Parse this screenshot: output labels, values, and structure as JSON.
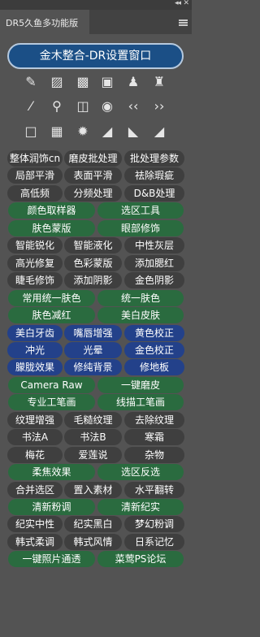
{
  "panel": {
    "title": "DR5久鱼多功能版",
    "collapse_glyph": "◂◂",
    "close_glyph": "✕"
  },
  "main_button": "金木整合-DR设置窗口",
  "icon_rows": [
    [
      {
        "name": "brush-swap-icon",
        "glyph": "✎"
      },
      {
        "name": "bandage-icon",
        "glyph": "▨"
      },
      {
        "name": "bandage-small-icon",
        "glyph": "▩"
      },
      {
        "name": "chip-icon",
        "glyph": "▣"
      },
      {
        "name": "stamp-icon",
        "glyph": "♟"
      },
      {
        "name": "clone-stamp-icon",
        "glyph": "♜"
      }
    ],
    [
      {
        "name": "brush-icon",
        "glyph": "⁄"
      },
      {
        "name": "magnifier-icon",
        "glyph": "⚲"
      },
      {
        "name": "split-view-icon",
        "glyph": "◫"
      },
      {
        "name": "eye-icon",
        "glyph": "◉"
      },
      {
        "name": "chevron-left-icon",
        "glyph": "‹‹"
      },
      {
        "name": "chevron-right-icon",
        "glyph": "››"
      }
    ],
    [
      {
        "name": "white-square-icon",
        "glyph": "□"
      },
      {
        "name": "gradient-icon",
        "glyph": "▦"
      },
      {
        "name": "sparkle-icon",
        "glyph": "✹"
      },
      {
        "name": "levels-icon",
        "glyph": "◢"
      },
      {
        "name": "histogram-icon",
        "glyph": "◣"
      },
      {
        "name": "histogram-alt-icon",
        "glyph": "◢"
      }
    ]
  ],
  "rows": [
    {
      "color": "gray",
      "buttons": [
        "整体润饰cn",
        "磨皮批处理",
        "批处理参数"
      ]
    },
    {
      "color": "gray",
      "buttons": [
        "局部平滑",
        "表面平滑",
        "祛除瑕疵"
      ]
    },
    {
      "color": "gray",
      "buttons": [
        "高低频",
        "分频处理",
        "D&B处理"
      ]
    },
    {
      "color": "green",
      "buttons": [
        "颜色取样器",
        "选区工具"
      ]
    },
    {
      "color": "green",
      "buttons": [
        "肤色蒙版",
        "眼部修饰"
      ]
    },
    {
      "color": "gray",
      "buttons": [
        "智能锐化",
        "智能液化",
        "中性灰层"
      ]
    },
    {
      "color": "gray",
      "buttons": [
        "高光修复",
        "色彩蒙版",
        "添加腮红"
      ]
    },
    {
      "color": "gray",
      "buttons": [
        "睫毛修饰",
        "添加阴影",
        "金色阴影"
      ]
    },
    {
      "color": "green",
      "buttons": [
        "常用统一肤色",
        "统一肤色"
      ]
    },
    {
      "color": "green",
      "buttons": [
        "肤色减红",
        "美白皮肤"
      ]
    },
    {
      "color": "blue",
      "buttons": [
        "美白牙齿",
        "嘴唇增强",
        "黄色校正"
      ]
    },
    {
      "color": "blue",
      "buttons": [
        "冲光",
        "光晕",
        "金色校正"
      ]
    },
    {
      "color": "blue",
      "buttons": [
        "朦胧效果",
        "修纯背景",
        "修地板"
      ]
    },
    {
      "color": "green",
      "buttons": [
        "Camera Raw",
        "一键磨皮"
      ]
    },
    {
      "color": "green",
      "buttons": [
        "专业工笔画",
        "线描工笔画"
      ]
    },
    {
      "color": "gray",
      "buttons": [
        "纹理增强",
        "毛糙纹理",
        "去除纹理"
      ]
    },
    {
      "color": "gray",
      "buttons": [
        "书法A",
        "书法B",
        "寒霜"
      ]
    },
    {
      "color": "gray",
      "buttons": [
        "梅花",
        "爱莲说",
        "杂物"
      ]
    },
    {
      "color": "green",
      "buttons": [
        "柔焦效果",
        "选区反选"
      ]
    },
    {
      "color": "gray",
      "buttons": [
        "合并选区",
        "置入素材",
        "水平翻转"
      ]
    },
    {
      "color": "green",
      "buttons": [
        "清新粉调",
        "清新纪实"
      ]
    },
    {
      "color": "gray",
      "buttons": [
        "纪实中性",
        "纪实黑白",
        "梦幻粉调"
      ]
    },
    {
      "color": "gray",
      "buttons": [
        "韩式柔调",
        "韩式风情",
        "日系记忆"
      ]
    },
    {
      "color": "green",
      "buttons": [
        "一键照片通透",
        "菜莺PS论坛"
      ]
    }
  ],
  "colors": {
    "panel_bg": "#535353",
    "gray_button": "#3f3f3f",
    "green_button": "#2a6b3f",
    "blue_button": "#23418a",
    "main_button": "#1b4f86"
  }
}
